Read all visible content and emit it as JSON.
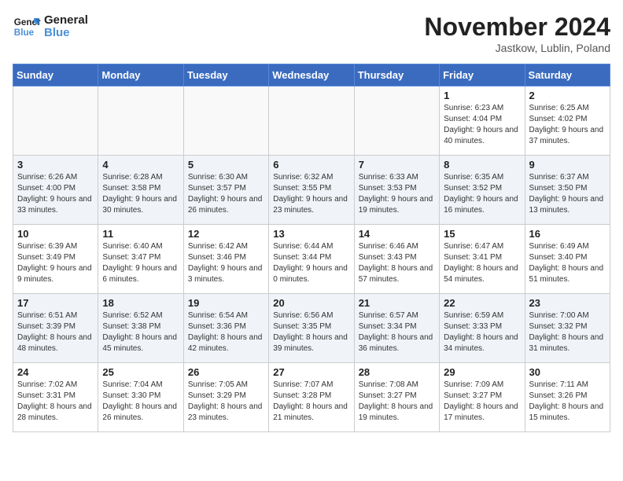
{
  "logo": {
    "line1": "General",
    "line2": "Blue"
  },
  "title": "November 2024",
  "subtitle": "Jastkow, Lublin, Poland",
  "weekdays": [
    "Sunday",
    "Monday",
    "Tuesday",
    "Wednesday",
    "Thursday",
    "Friday",
    "Saturday"
  ],
  "weeks": [
    [
      {
        "day": "",
        "info": ""
      },
      {
        "day": "",
        "info": ""
      },
      {
        "day": "",
        "info": ""
      },
      {
        "day": "",
        "info": ""
      },
      {
        "day": "",
        "info": ""
      },
      {
        "day": "1",
        "info": "Sunrise: 6:23 AM\nSunset: 4:04 PM\nDaylight: 9 hours and 40 minutes."
      },
      {
        "day": "2",
        "info": "Sunrise: 6:25 AM\nSunset: 4:02 PM\nDaylight: 9 hours and 37 minutes."
      }
    ],
    [
      {
        "day": "3",
        "info": "Sunrise: 6:26 AM\nSunset: 4:00 PM\nDaylight: 9 hours and 33 minutes."
      },
      {
        "day": "4",
        "info": "Sunrise: 6:28 AM\nSunset: 3:58 PM\nDaylight: 9 hours and 30 minutes."
      },
      {
        "day": "5",
        "info": "Sunrise: 6:30 AM\nSunset: 3:57 PM\nDaylight: 9 hours and 26 minutes."
      },
      {
        "day": "6",
        "info": "Sunrise: 6:32 AM\nSunset: 3:55 PM\nDaylight: 9 hours and 23 minutes."
      },
      {
        "day": "7",
        "info": "Sunrise: 6:33 AM\nSunset: 3:53 PM\nDaylight: 9 hours and 19 minutes."
      },
      {
        "day": "8",
        "info": "Sunrise: 6:35 AM\nSunset: 3:52 PM\nDaylight: 9 hours and 16 minutes."
      },
      {
        "day": "9",
        "info": "Sunrise: 6:37 AM\nSunset: 3:50 PM\nDaylight: 9 hours and 13 minutes."
      }
    ],
    [
      {
        "day": "10",
        "info": "Sunrise: 6:39 AM\nSunset: 3:49 PM\nDaylight: 9 hours and 9 minutes."
      },
      {
        "day": "11",
        "info": "Sunrise: 6:40 AM\nSunset: 3:47 PM\nDaylight: 9 hours and 6 minutes."
      },
      {
        "day": "12",
        "info": "Sunrise: 6:42 AM\nSunset: 3:46 PM\nDaylight: 9 hours and 3 minutes."
      },
      {
        "day": "13",
        "info": "Sunrise: 6:44 AM\nSunset: 3:44 PM\nDaylight: 9 hours and 0 minutes."
      },
      {
        "day": "14",
        "info": "Sunrise: 6:46 AM\nSunset: 3:43 PM\nDaylight: 8 hours and 57 minutes."
      },
      {
        "day": "15",
        "info": "Sunrise: 6:47 AM\nSunset: 3:41 PM\nDaylight: 8 hours and 54 minutes."
      },
      {
        "day": "16",
        "info": "Sunrise: 6:49 AM\nSunset: 3:40 PM\nDaylight: 8 hours and 51 minutes."
      }
    ],
    [
      {
        "day": "17",
        "info": "Sunrise: 6:51 AM\nSunset: 3:39 PM\nDaylight: 8 hours and 48 minutes."
      },
      {
        "day": "18",
        "info": "Sunrise: 6:52 AM\nSunset: 3:38 PM\nDaylight: 8 hours and 45 minutes."
      },
      {
        "day": "19",
        "info": "Sunrise: 6:54 AM\nSunset: 3:36 PM\nDaylight: 8 hours and 42 minutes."
      },
      {
        "day": "20",
        "info": "Sunrise: 6:56 AM\nSunset: 3:35 PM\nDaylight: 8 hours and 39 minutes."
      },
      {
        "day": "21",
        "info": "Sunrise: 6:57 AM\nSunset: 3:34 PM\nDaylight: 8 hours and 36 minutes."
      },
      {
        "day": "22",
        "info": "Sunrise: 6:59 AM\nSunset: 3:33 PM\nDaylight: 8 hours and 34 minutes."
      },
      {
        "day": "23",
        "info": "Sunrise: 7:00 AM\nSunset: 3:32 PM\nDaylight: 8 hours and 31 minutes."
      }
    ],
    [
      {
        "day": "24",
        "info": "Sunrise: 7:02 AM\nSunset: 3:31 PM\nDaylight: 8 hours and 28 minutes."
      },
      {
        "day": "25",
        "info": "Sunrise: 7:04 AM\nSunset: 3:30 PM\nDaylight: 8 hours and 26 minutes."
      },
      {
        "day": "26",
        "info": "Sunrise: 7:05 AM\nSunset: 3:29 PM\nDaylight: 8 hours and 23 minutes."
      },
      {
        "day": "27",
        "info": "Sunrise: 7:07 AM\nSunset: 3:28 PM\nDaylight: 8 hours and 21 minutes."
      },
      {
        "day": "28",
        "info": "Sunrise: 7:08 AM\nSunset: 3:27 PM\nDaylight: 8 hours and 19 minutes."
      },
      {
        "day": "29",
        "info": "Sunrise: 7:09 AM\nSunset: 3:27 PM\nDaylight: 8 hours and 17 minutes."
      },
      {
        "day": "30",
        "info": "Sunrise: 7:11 AM\nSunset: 3:26 PM\nDaylight: 8 hours and 15 minutes."
      }
    ]
  ]
}
